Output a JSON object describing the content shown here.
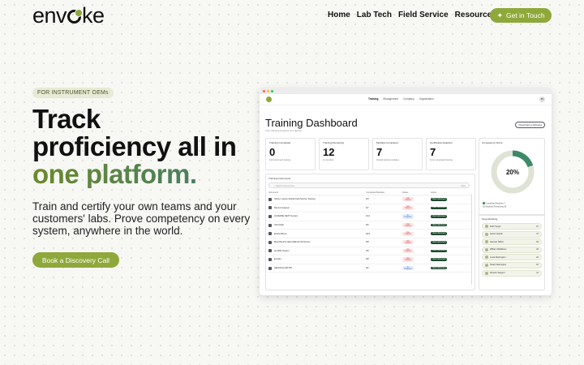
{
  "brand": {
    "logo_pre": "env",
    "logo_post": "ke",
    "accent": "#8fa83a"
  },
  "nav": {
    "items": [
      "Home",
      "Lab Tech",
      "Field Service",
      "Resources"
    ],
    "cta": "Get in Touch",
    "cta_icon": "sparkle-icon"
  },
  "hero": {
    "tag": "FOR INSTRUMENT OEMs",
    "title_line1": "Track",
    "title_line2": "proficiency all in",
    "title_accent": "one platform.",
    "subtitle": "Train and certify your own teams and your customers' labs. Prove competency on every system, anywhere in the world.",
    "cta": "Book a Discovery Call"
  },
  "dashboard": {
    "tabs": [
      "Training",
      "Management",
      "Company",
      "Organization"
    ],
    "avatar": "BT",
    "title": "Training Dashboard",
    "subtitle": "Your training progress at a glance",
    "download": "Download certificates",
    "stats": [
      {
        "label": "Training Completed",
        "value": "0",
        "foot": "Full instrument training"
      },
      {
        "label": "Training Remaining",
        "value": "12",
        "foot": "to complete"
      },
      {
        "label": "Modules Completed",
        "value": "7",
        "foot": "Overall training modules"
      },
      {
        "label": "Certificates Awarded",
        "value": "7",
        "foot": "From completed training"
      }
    ],
    "competency": {
      "label": "Competency Score",
      "value": "20%",
      "fraction": 0.2,
      "legend": [
        {
          "label": "Completed Modules",
          "value": "7",
          "color": "#3c8a68"
        },
        {
          "label": "Modules Remaining",
          "value": "28",
          "color": "#cfd6c4"
        }
      ]
    },
    "instruments": {
      "label": "Training Instruments",
      "search_placeholder": "Search instruments...",
      "filter": "Filter",
      "headers": [
        "Instrument",
        "Completed Modules",
        "Status",
        "Action"
      ],
      "rows": [
        {
          "name": "Alinity c-series Global Field Service Training",
          "modules": "0/4",
          "status": "Not Started"
        },
        {
          "name": "Ramuti Analyser",
          "modules": "0/7",
          "status": "Not Started"
        },
        {
          "name": "HI-SENSE NEXT System",
          "modules": "1/12",
          "status": "In Progress"
        },
        {
          "name": "Ishii Hitide",
          "modules": "0/6",
          "status": "Not Started"
        },
        {
          "name": "Endra Mbono",
          "modules": "0/15",
          "status": "Not Started"
        },
        {
          "name": "BloodTouch1 HaemoBank3 3D Device",
          "modules": "0/8",
          "status": "Not Started"
        },
        {
          "name": "HI-3000 System",
          "modules": "0/8",
          "status": "Not Started"
        },
        {
          "name": "Emolax",
          "modules": "0/8",
          "status": "Not Started"
        },
        {
          "name": "HEHO/etta HB 600",
          "modules": "0/2",
          "status": "In Progress"
        }
      ],
      "action": "View Instrument"
    },
    "ranking": {
      "label": "Team Ranking",
      "rows": [
        {
          "name": "Ruth Tango",
          "score": "67"
        },
        {
          "name": "Hazen Hardin",
          "score": "47"
        },
        {
          "name": "Hannah Talbot",
          "score": "34"
        },
        {
          "name": "William Middleton",
          "score": "34"
        },
        {
          "name": "Lucia Warrington",
          "score": "22"
        },
        {
          "name": "Stuart Warrington",
          "score": "19"
        },
        {
          "name": "Weston Sargent",
          "score": "11"
        }
      ]
    }
  }
}
